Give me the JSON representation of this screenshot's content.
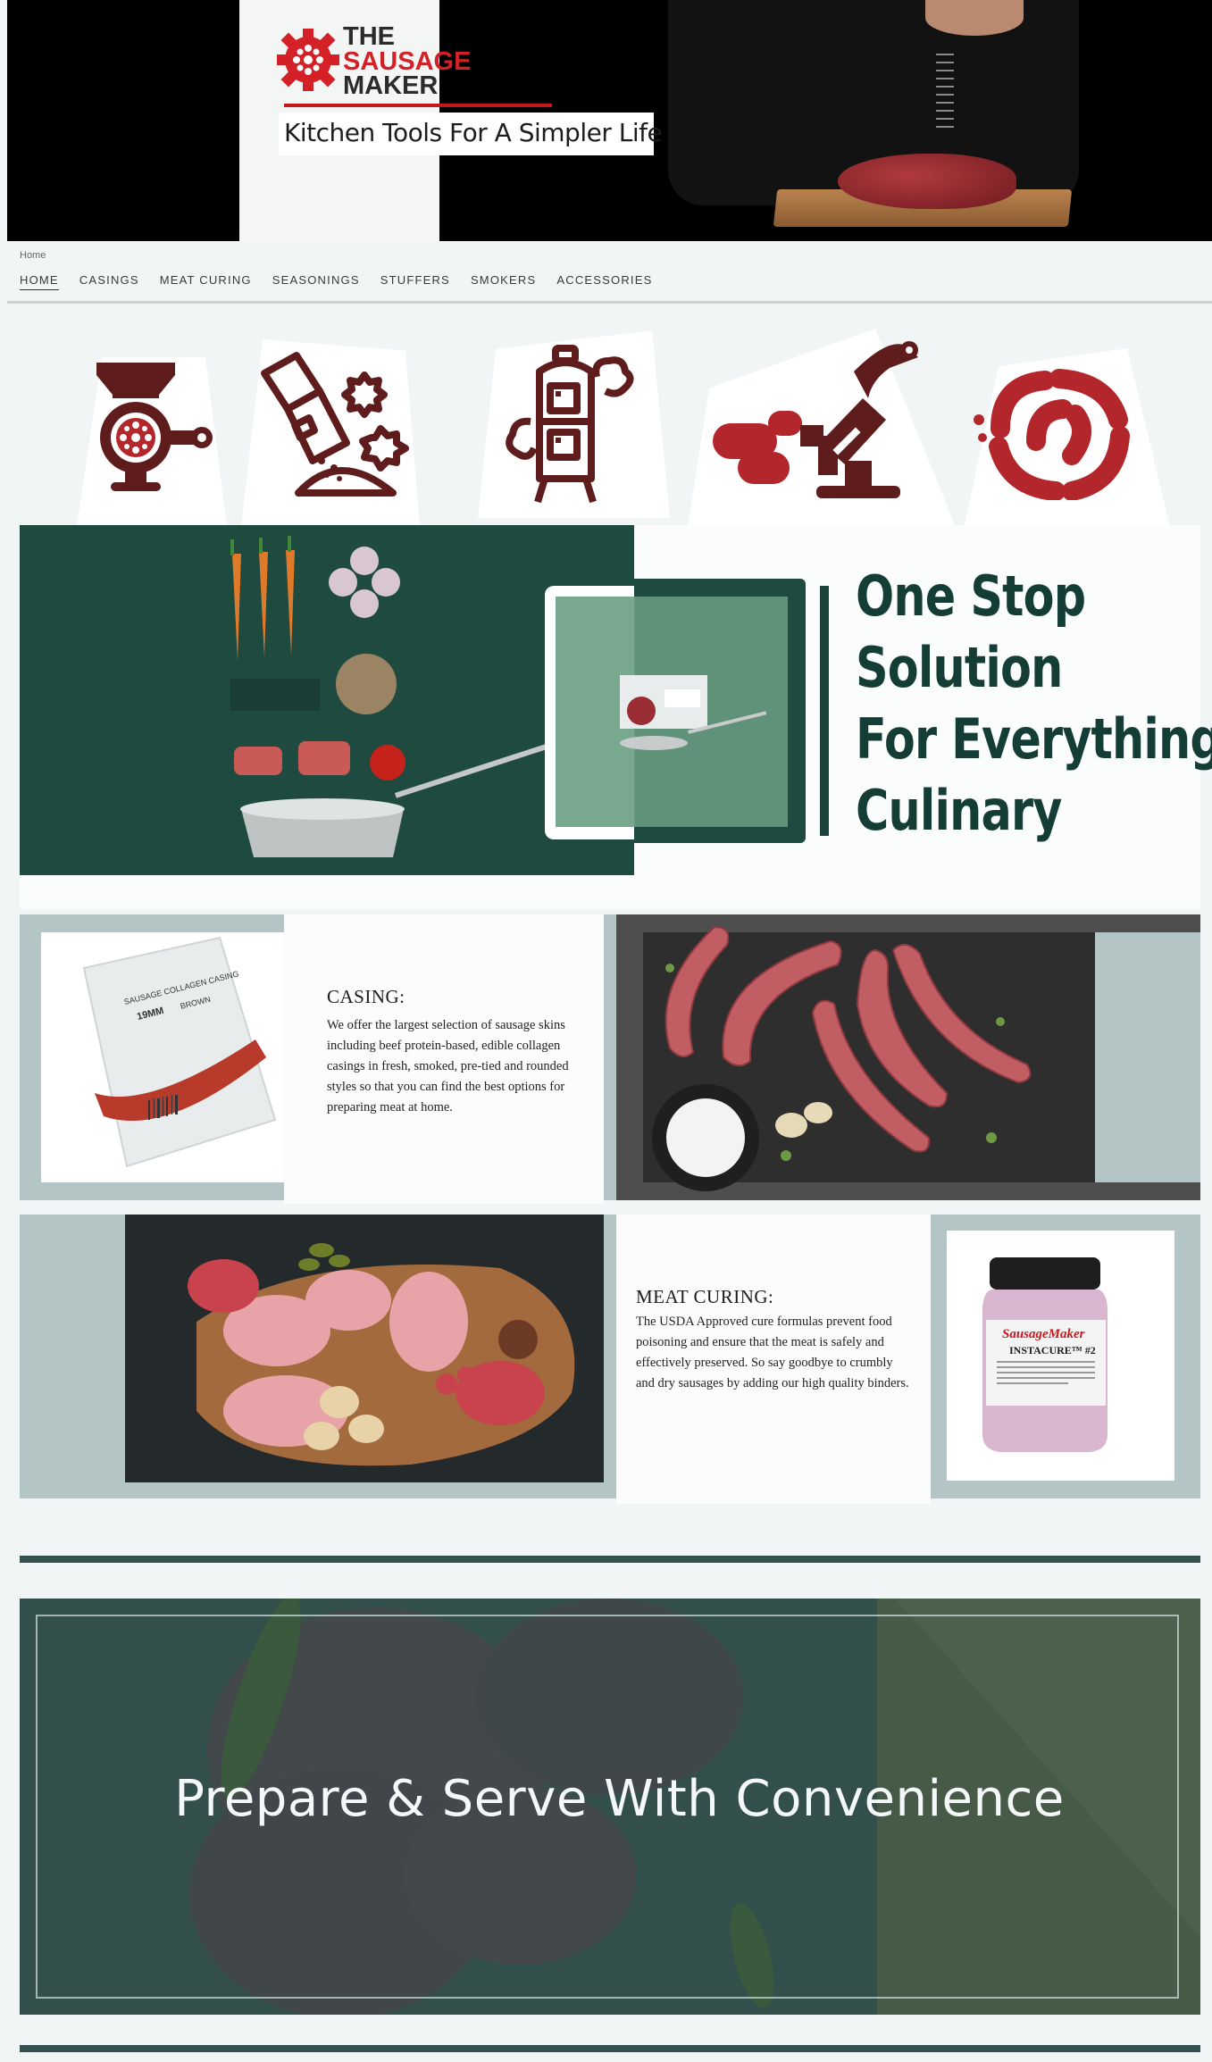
{
  "brand": {
    "line1": "THE",
    "line2": "SAUSAGE",
    "line3": "MAKER",
    "tagline": "Kitchen Tools For A Simpler Life",
    "accent": "#c8161d"
  },
  "breadcrumb": "Home",
  "nav": {
    "items": [
      "HOME",
      "CASINGS",
      "MEAT CURING",
      "SEASONINGS",
      "STUFFERS",
      "SMOKERS",
      "ACCESSORIES"
    ],
    "active": "HOME"
  },
  "icons": [
    "meat-grinder-icon",
    "seasoning-shaker-icon",
    "smoker-icon",
    "sausage-stuffer-icon",
    "sausage-links-icon"
  ],
  "hero": {
    "lines": [
      "One Stop",
      "Solution",
      "For Everything",
      "Culinary"
    ],
    "color": "#143d36"
  },
  "casing": {
    "title": "CASING:",
    "body": "We offer the largest selection of sausage skins including beef protein-based, edible collagen casings in fresh, smoked, pre-tied and rounded styles so that you can find the best options for preparing meat at home.",
    "package_label": "SAUSAGE COLLAGEN CASING",
    "package_size": "19MM",
    "package_color": "BROWN"
  },
  "curing": {
    "title": "MEAT CURING:",
    "body": "The USDA Approved cure formulas prevent food poisoning and ensure that the meat is safely and effectively preserved. So say goodbye to crumbly and dry sausages by adding our high quality binders.",
    "jar_brand": "SausageMaker",
    "jar_label": "INSTACURE™ #2"
  },
  "promo": {
    "title": "Prepare & Serve With Convenience"
  }
}
